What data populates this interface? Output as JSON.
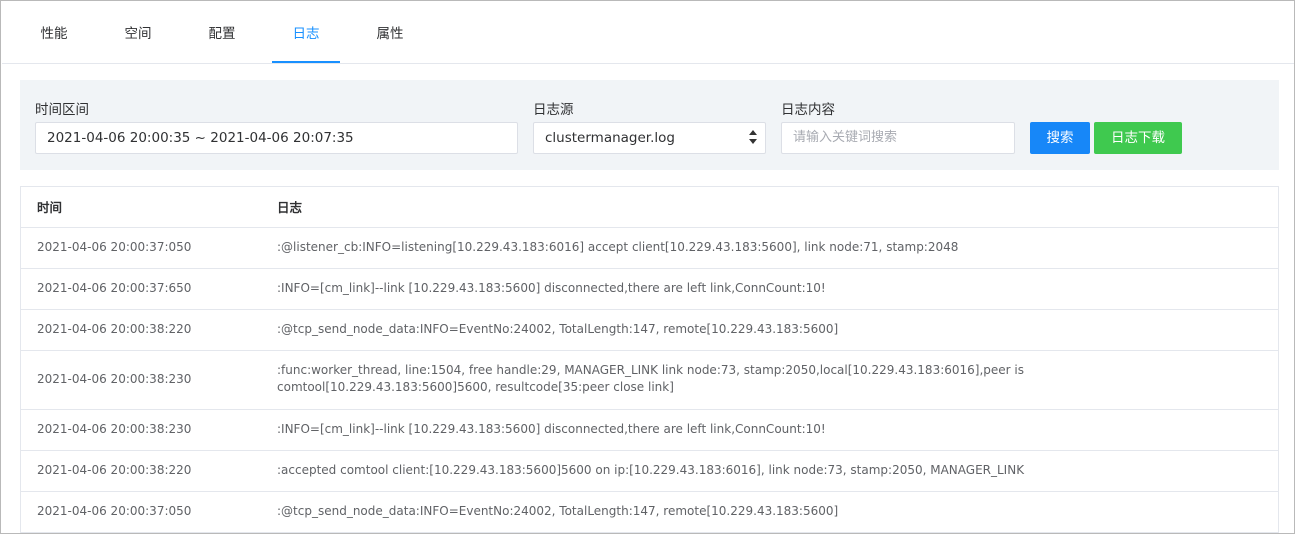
{
  "tabs": [
    {
      "label": "性能",
      "active": false
    },
    {
      "label": "空间",
      "active": false
    },
    {
      "label": "配置",
      "active": false
    },
    {
      "label": "日志",
      "active": true
    },
    {
      "label": "属性",
      "active": false
    }
  ],
  "filter": {
    "time_range_label": "时间区间",
    "time_range_value": "2021-04-06 20:00:35 ~ 2021-04-06 20:07:35",
    "log_source_label": "日志源",
    "log_source_value": "clustermanager.log",
    "log_content_label": "日志内容",
    "log_content_placeholder": "请输入关键词搜索",
    "search_button": "搜索",
    "download_button": "日志下载"
  },
  "table": {
    "headers": {
      "time": "时间",
      "log": "日志"
    },
    "rows": [
      {
        "time": "2021-04-06 20:00:37:050",
        "log": ":@listener_cb:INFO=listening[10.229.43.183:6016] accept client[10.229.43.183:5600], link node:71, stamp:2048"
      },
      {
        "time": "2021-04-06 20:00:37:650",
        "log": ":INFO=[cm_link]--link [10.229.43.183:5600] disconnected,there are left link,ConnCount:10!"
      },
      {
        "time": "2021-04-06 20:00:38:220",
        "log": ":@tcp_send_node_data:INFO=EventNo:24002, TotalLength:147, remote[10.229.43.183:5600]"
      },
      {
        "time": "2021-04-06 20:00:38:230",
        "log": ":func:worker_thread, line:1504, free handle:29, MANAGER_LINK link node:73, stamp:2050,local[10.229.43.183:6016],peer is comtool[10.229.43.183:5600]5600, resultcode[35:peer close link]"
      },
      {
        "time": "2021-04-06 20:00:38:230",
        "log": ":INFO=[cm_link]--link [10.229.43.183:5600] disconnected,there are left link,ConnCount:10!"
      },
      {
        "time": "2021-04-06 20:00:38:220",
        "log": ":accepted comtool client:[10.229.43.183:5600]5600 on ip:[10.229.43.183:6016], link node:73, stamp:2050, MANAGER_LINK"
      },
      {
        "time": "2021-04-06 20:00:37:050",
        "log": ":@tcp_send_node_data:INFO=EventNo:24002, TotalLength:147, remote[10.229.43.183:5600]"
      }
    ]
  },
  "colors": {
    "accent": "#1890ff",
    "search_button": "#1787f8",
    "download_button": "#3fc94f",
    "filter_bg": "#f1f4f7"
  }
}
